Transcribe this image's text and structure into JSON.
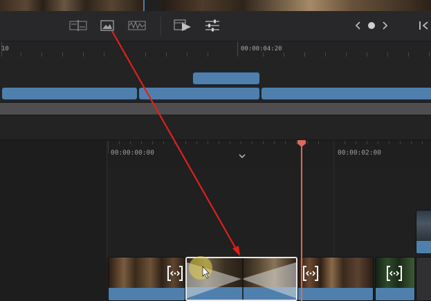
{
  "ruler_upper": {
    "tc_left": "10",
    "tc_main": "00:00:04:20"
  },
  "ruler_lower": {
    "tc_start": "00:00:00:00",
    "tc_two": "00:00:02:00"
  },
  "toolbar": {
    "icons": [
      "split-view-icon",
      "image-overlay-icon",
      "waveform-icon",
      "play-range-icon",
      "mixer-sliders-icon",
      "chevron-left-icon",
      "dot-icon",
      "chevron-right-icon",
      "skip-end-icon"
    ]
  },
  "colors": {
    "clip_blue": "#4f80ad",
    "playhead": "#e2675a",
    "annotation_arrow": "#e0201b",
    "highlight_cursor": "#e6d24a"
  },
  "transition_badge_icon": "transition-bracket-icon"
}
